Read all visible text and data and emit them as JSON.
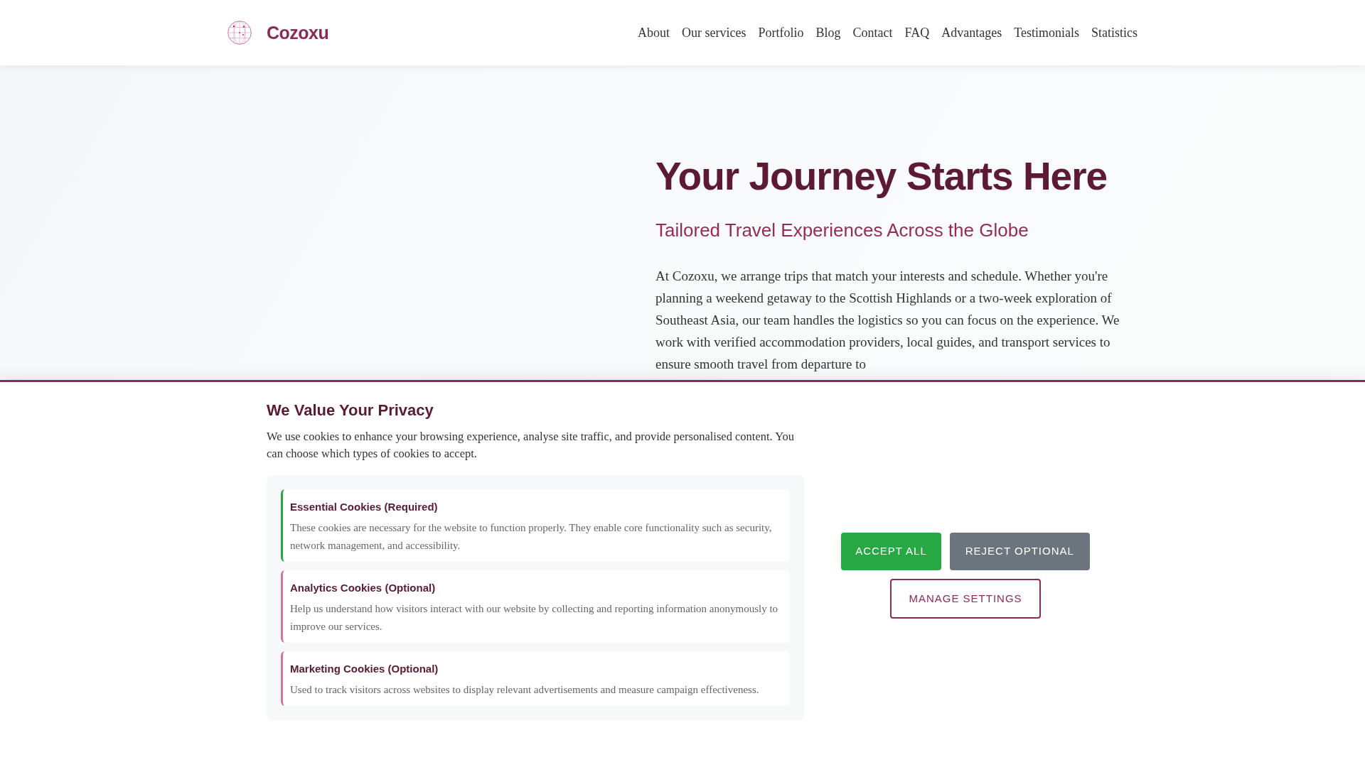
{
  "header": {
    "brand": "Cozoxu",
    "nav": [
      {
        "label": "About"
      },
      {
        "label": "Our services"
      },
      {
        "label": "Portfolio"
      },
      {
        "label": "Blog"
      },
      {
        "label": "Contact"
      },
      {
        "label": "FAQ"
      },
      {
        "label": "Advantages"
      },
      {
        "label": "Testimonials"
      },
      {
        "label": "Statistics"
      }
    ]
  },
  "hero": {
    "title": "Your Journey Starts Here",
    "subtitle": "Tailored Travel Experiences Across the Globe",
    "paragraph": "At Cozoxu, we arrange trips that match your interests and schedule. Whether you're planning a weekend getaway to the Scottish Highlands or a two-week exploration of Southeast Asia, our team handles the logistics so you can focus on the experience. We work with verified accommodation providers, local guides, and transport services to ensure smooth travel from departure to"
  },
  "cookie_banner": {
    "title": "We Value Your Privacy",
    "description": "We use cookies to enhance your browsing experience, analyse site traffic, and provide personalised content. You can choose which types of cookies to accept.",
    "categories": [
      {
        "title": "Essential Cookies (Required)",
        "description": "These cookies are necessary for the website to function properly. They enable core functionality such as security, network management, and accessibility.",
        "color": "#28a745"
      },
      {
        "title": "Analytics Cookies (Optional)",
        "description": "Help us understand how visitors interact with our website by collecting and reporting information anonymously to improve our services.",
        "color": "#d4739d"
      },
      {
        "title": "Marketing Cookies (Optional)",
        "description": "Used to track visitors across websites to display relevant advertisements and measure campaign effectiveness.",
        "color": "#d4739d"
      }
    ],
    "buttons": [
      {
        "label": "ACCEPT ALL",
        "kind": "primary"
      },
      {
        "label": "REJECT OPTIONAL",
        "kind": "secondary"
      },
      {
        "label": "MANAGE SETTINGS",
        "kind": "outline"
      }
    ]
  }
}
